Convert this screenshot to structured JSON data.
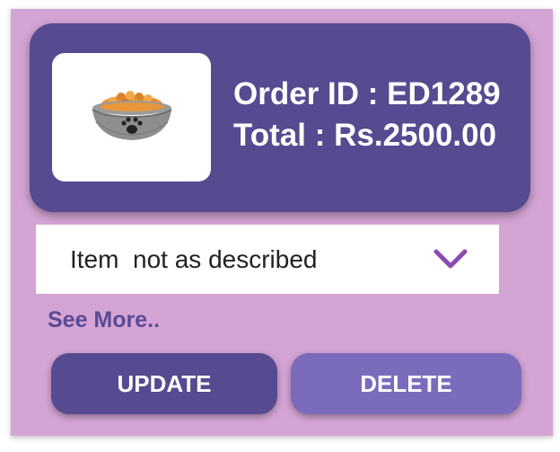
{
  "order": {
    "id_text": "Order ID : ED1289",
    "total_text": "Total : Rs.2500.00",
    "image_icon": "pet-food-bowl-icon"
  },
  "reason_select": {
    "selected": "Item  not as described",
    "icon": "chevron-down-icon"
  },
  "links": {
    "see_more": "See More.."
  },
  "actions": {
    "update_label": "UPDATE",
    "delete_label": "DELETE"
  },
  "colors": {
    "background": "#d4a4d4",
    "card": "#564a91",
    "update_button": "#564a91",
    "delete_button": "#7a6bbd",
    "chevron": "#8a4bb0"
  }
}
